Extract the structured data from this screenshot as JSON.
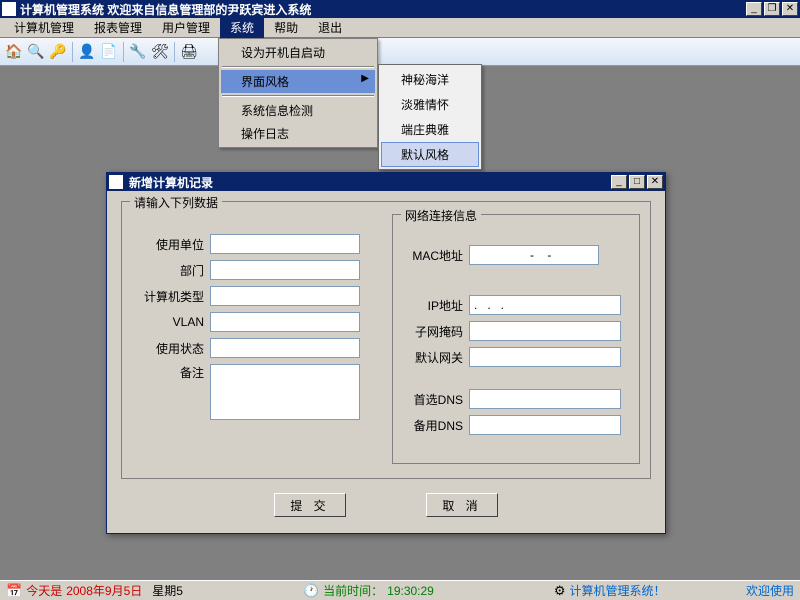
{
  "title": "计算机管理系统   欢迎来自信息管理部的尹跃宾进入系统",
  "menubar": [
    "计算机管理",
    "报表管理",
    "用户管理",
    "系统",
    "帮助",
    "退出"
  ],
  "menubar_open_index": 3,
  "sysmenu": {
    "items": [
      {
        "label": "设为开机自启动"
      },
      {
        "label": "界面风格",
        "submenu": true,
        "hl": true
      },
      {
        "label": "系统信息检测"
      },
      {
        "label": "操作日志"
      }
    ]
  },
  "stylemenu": {
    "items": [
      {
        "label": "神秘海洋"
      },
      {
        "label": "淡雅情怀"
      },
      {
        "label": "端庄典雅"
      },
      {
        "label": "默认风格",
        "hl": true
      }
    ]
  },
  "dialog": {
    "title": "新增计算机记录",
    "group_main": "请输入下列数据",
    "group_net": "网络连接信息",
    "labels": {
      "unit": "使用单位",
      "dept": "部门",
      "type": "计算机类型",
      "vlan": "VLAN",
      "status": "使用状态",
      "remark": "备注",
      "mac": "MAC地址",
      "ip": "IP地址",
      "mask": "子网掩码",
      "gw": "默认网关",
      "dns1": "首选DNS",
      "dns2": "备用DNS"
    },
    "values": {
      "unit": "",
      "dept": "",
      "type": "",
      "vlan": "",
      "status": "",
      "remark": "",
      "mac": "    -    -",
      "ip": ".   .   .",
      "mask": "",
      "gw": "",
      "dns1": "",
      "dns2": ""
    },
    "submit": "提 交",
    "cancel": "取 消"
  },
  "status": {
    "date_label": "今天是",
    "date": "2008年9月5日",
    "weekday": "星期5",
    "time_label": "当前时间：",
    "time": "19:30:29",
    "sys": "计算机管理系统！",
    "welcome": "欢迎使用"
  }
}
